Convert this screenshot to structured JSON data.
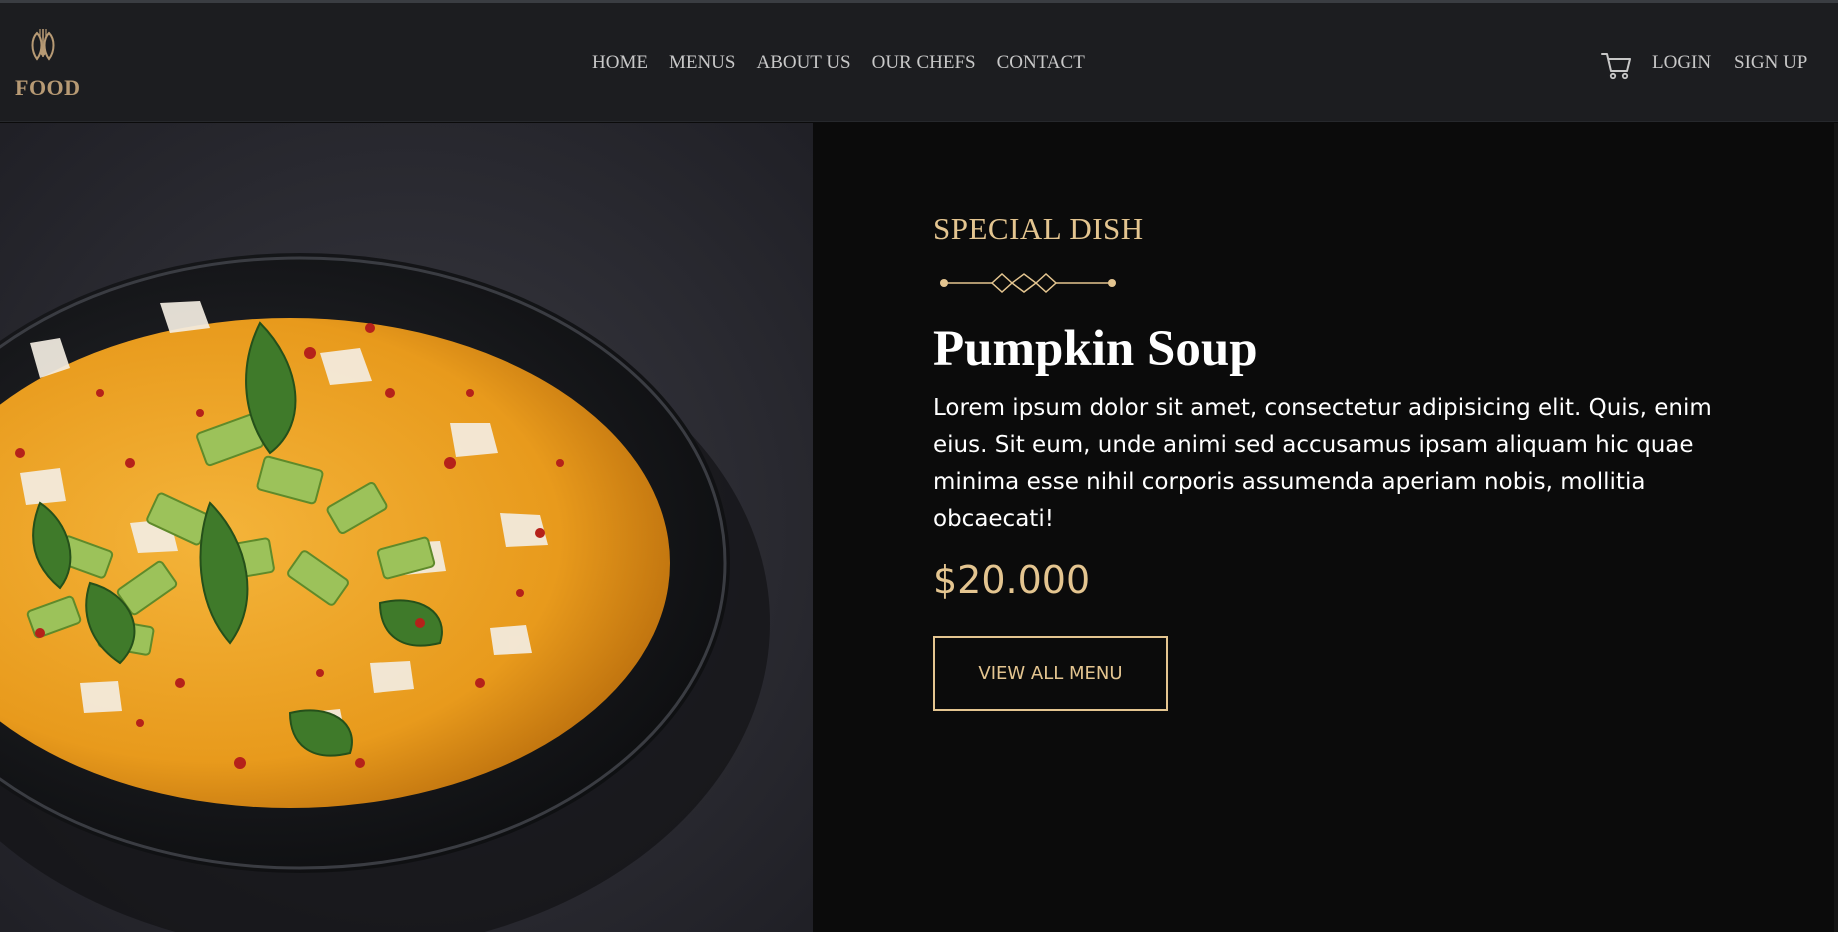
{
  "brand": {
    "name": "FOOD",
    "icon": "cutlery-leaf-icon",
    "color": "#b79a74"
  },
  "nav": {
    "items": [
      {
        "label": "HOME"
      },
      {
        "label": "MENUS"
      },
      {
        "label": "ABOUT US"
      },
      {
        "label": "OUR CHEFS"
      },
      {
        "label": "CONTACT"
      }
    ]
  },
  "header_actions": {
    "cart_icon": "shopping-cart-icon",
    "login_label": "LOGIN",
    "signup_label": "SIGN UP"
  },
  "hero": {
    "image": "pumpkin-soup-bowl-photo",
    "eyebrow": "SPECIAL DISH",
    "divider_icon": "ornamental-divider-icon",
    "title": "Pumpkin Soup",
    "description": "Lorem ipsum dolor sit amet, consectetur adipisicing elit. Quis, enim eius. Sit eum, unde animi sed accusamus ipsam aliquam hic quae minima esse nihil corporis assumenda aperiam nobis, mollitia obcaecati!",
    "price": "$20.000",
    "cta_label": "VIEW ALL MENU"
  },
  "colors": {
    "accent": "#e4c590",
    "header_bg": "#1c1d20",
    "page_bg": "#0b0b0b",
    "soup": "#e89a1c"
  }
}
